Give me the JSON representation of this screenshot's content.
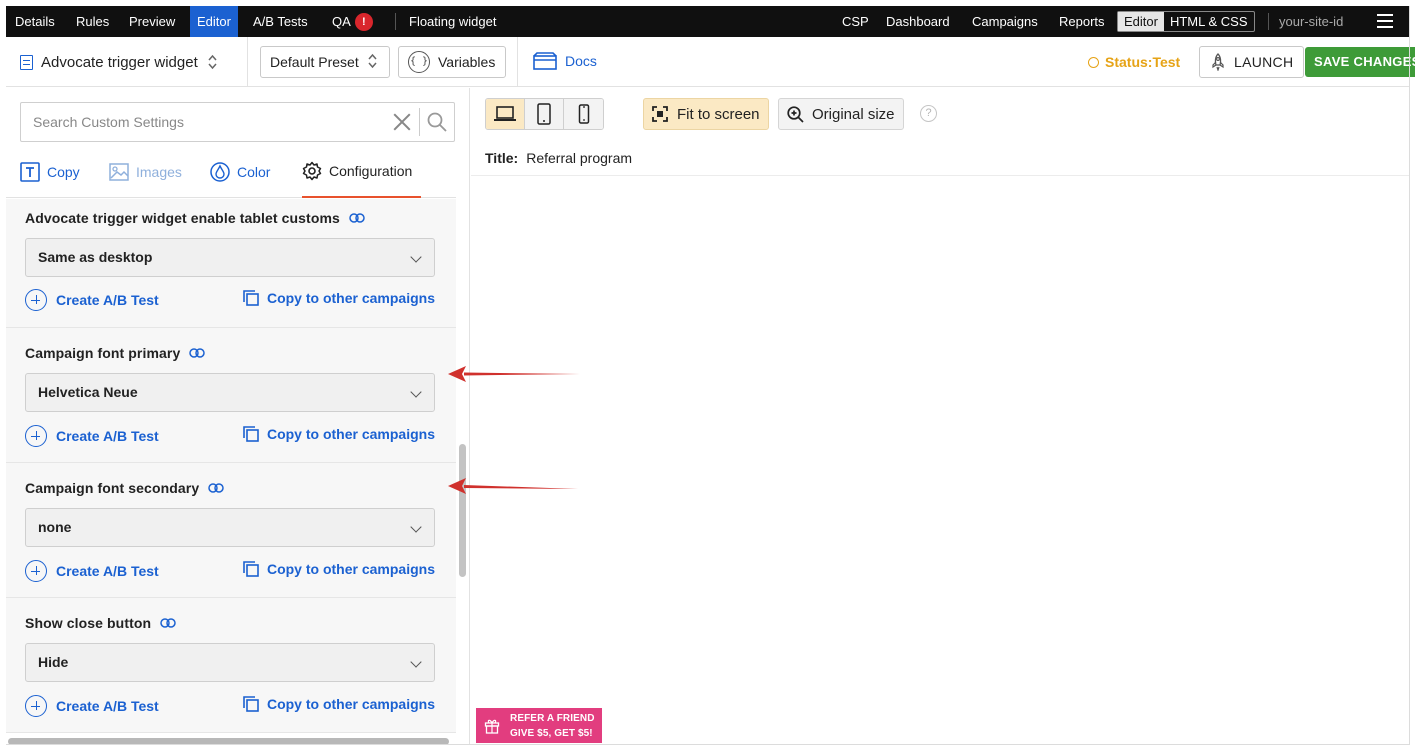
{
  "topnav": {
    "left_items": [
      "Details",
      "Rules",
      "Preview",
      "Editor",
      "A/B Tests",
      "QA"
    ],
    "active_item": "Editor",
    "qa_badge": "!",
    "context_label": "Floating widget",
    "right_items": [
      "CSP",
      "Dashboard",
      "Campaigns",
      "Reports"
    ],
    "mode_toggle": {
      "editor": "Editor",
      "html_css": "HTML & CSS"
    },
    "site_id": "your-site-id",
    "menu_icon": "hamburger-icon"
  },
  "toolbar": {
    "widget_name": "Advocate trigger widget",
    "preset": "Default Preset",
    "variables_label": "Variables",
    "variables_icon": "{ }",
    "docs_label": "Docs",
    "status_prefix": "Status:",
    "status_value": "Test",
    "launch_label": "LAUNCH",
    "save_label": "SAVE CHANGES"
  },
  "sidebar": {
    "search_placeholder": "Search Custom Settings",
    "tabs": [
      {
        "label": "Copy",
        "icon": "text-icon"
      },
      {
        "label": "Images",
        "icon": "image-icon"
      },
      {
        "label": "Color",
        "icon": "droplet-icon"
      },
      {
        "label": "Configuration",
        "icon": "gear-icon"
      }
    ],
    "active_tab": "Configuration",
    "settings": [
      {
        "label": "Advocate trigger widget enable tablet customs",
        "value": "Same as desktop",
        "ab_label": "Create A/B Test",
        "copy_label": "Copy to other campaigns"
      },
      {
        "label": "Campaign font primary",
        "value": "Helvetica Neue",
        "ab_label": "Create A/B Test",
        "copy_label": "Copy to other campaigns"
      },
      {
        "label": "Campaign font secondary",
        "value": "none",
        "ab_label": "Create A/B Test",
        "copy_label": "Copy to other campaigns"
      },
      {
        "label": "Show close button",
        "value": "Hide",
        "ab_label": "Create A/B Test",
        "copy_label": "Copy to other campaigns"
      }
    ]
  },
  "preview": {
    "devices": [
      "laptop-icon",
      "tablet-icon",
      "phone-icon"
    ],
    "active_device": "laptop-icon",
    "fit_label": "Fit to screen",
    "original_label": "Original size",
    "help": "?",
    "title_label": "Title:",
    "title_value": "Referral program",
    "refer_line1": "REFER A FRIEND",
    "refer_line2": "GIVE $5, GET $5!"
  },
  "colors": {
    "accent": "#1b61d1",
    "save": "#3e9b38",
    "status": "#e6a316",
    "active_tab_underline": "#e8522d",
    "refer_widget": "#e23d7f",
    "annotation_arrow": "#d0312d"
  }
}
